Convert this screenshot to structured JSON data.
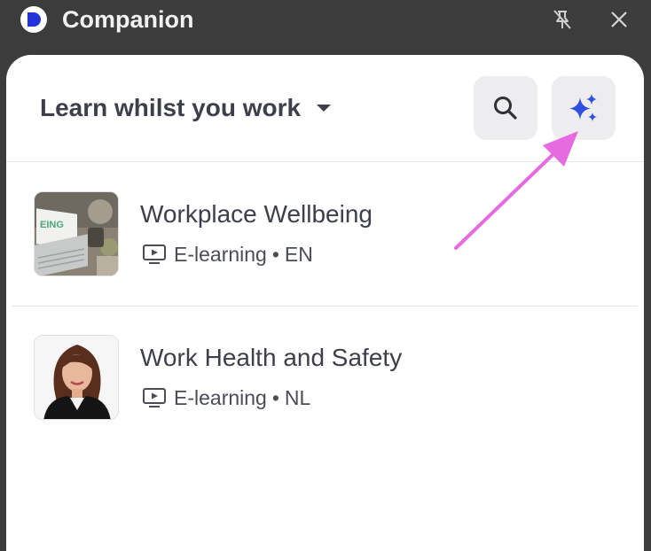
{
  "window": {
    "title": "Companion",
    "pin_icon": "unpin-icon",
    "close_icon": "close-icon"
  },
  "header": {
    "section_title": "Learn whilst you work",
    "search_icon": "search-icon",
    "ai_icon": "sparkle-icon"
  },
  "courses": [
    {
      "title": "Workplace Wellbeing",
      "type": "E-learning",
      "separator": "•",
      "language": "EN",
      "thumb": "laptop-desk-thumbnail"
    },
    {
      "title": "Work Health and Safety",
      "type": "E-learning",
      "separator": "•",
      "language": "NL",
      "thumb": "woman-portrait-thumbnail"
    }
  ],
  "colors": {
    "titlebar_bg": "#3c3c3c",
    "panel_bg": "#ffffff",
    "button_bg": "#ededf0",
    "accent": "#2f4fe0",
    "annotation_arrow": "#e66be0"
  }
}
